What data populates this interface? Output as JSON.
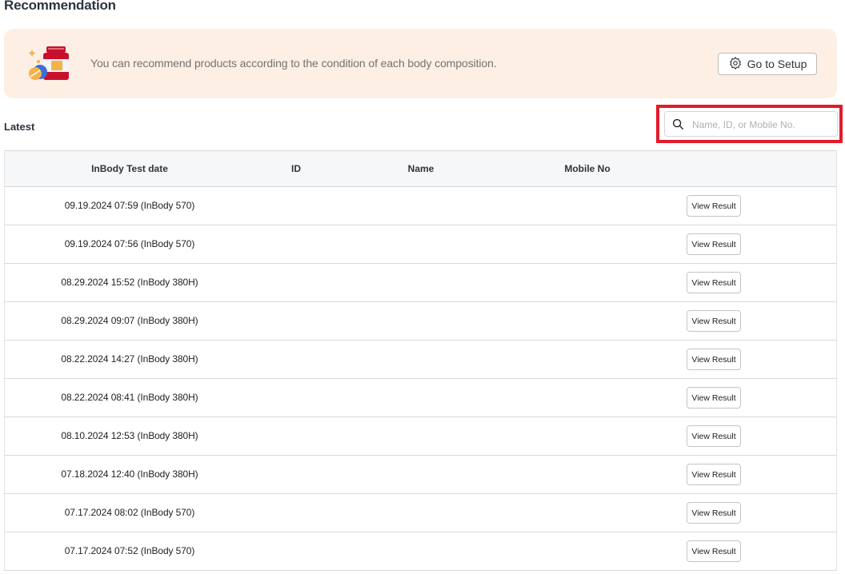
{
  "page": {
    "title": "Recommendation"
  },
  "banner": {
    "text": "You can recommend products according to the condition of each body composition.",
    "illustration_icon": "supplement-bottle-pills-icon",
    "setup_button_label": "Go to Setup",
    "setup_icon": "gear-icon",
    "background_color": "#fdefe3"
  },
  "section": {
    "label": "Latest"
  },
  "search": {
    "placeholder": "Name, ID, or Mobile No.",
    "value": "",
    "icon": "search-icon"
  },
  "table": {
    "headers": [
      "InBody Test date",
      "ID",
      "Name",
      "Mobile No"
    ],
    "rows": [
      {
        "date": "09.19.2024 07:59 (InBody 570)",
        "action": "View Result"
      },
      {
        "date": "09.19.2024 07:56 (InBody 570)",
        "action": "View Result"
      },
      {
        "date": "08.29.2024 15:52 (InBody 380H)",
        "action": "View Result"
      },
      {
        "date": "08.29.2024 09:07 (InBody 380H)",
        "action": "View Result"
      },
      {
        "date": "08.22.2024 14:27 (InBody 380H)",
        "action": "View Result"
      },
      {
        "date": "08.22.2024 08:41 (InBody 380H)",
        "action": "View Result"
      },
      {
        "date": "08.10.2024 12:53 (InBody 380H)",
        "action": "View Result"
      },
      {
        "date": "07.18.2024 12:40 (InBody 380H)",
        "action": "View Result"
      },
      {
        "date": "07.17.2024 08:02 (InBody 570)",
        "action": "View Result"
      },
      {
        "date": "07.17.2024 07:52 (InBody 570)",
        "action": "View Result"
      }
    ]
  },
  "colors": {
    "highlight": "#e21b2a",
    "accent_red": "#c8102e"
  }
}
